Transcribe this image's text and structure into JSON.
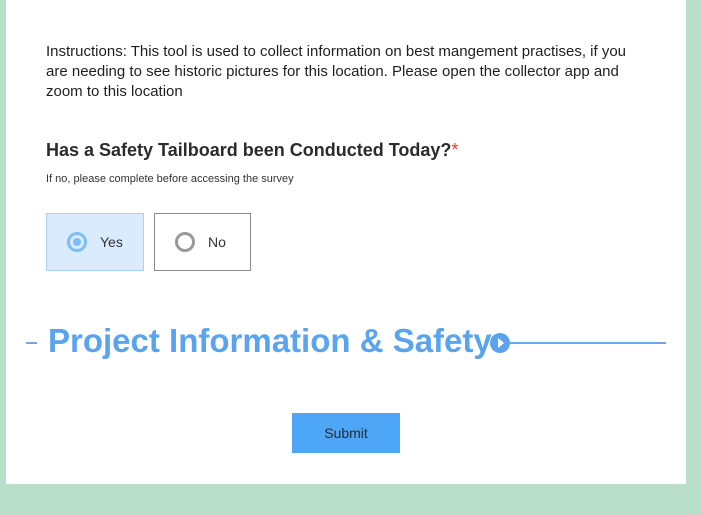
{
  "instructions": "Instructions: This tool is used to collect information on best mangement practises, if you are needing to see historic pictures for this location. Please open the collector app and zoom to this location",
  "question": {
    "label": "Has a Safety Tailboard been Conducted Today?",
    "required_mark": "*",
    "hint": "If no, please complete before accessing the survey",
    "options": [
      {
        "label": "Yes",
        "selected": true
      },
      {
        "label": "No",
        "selected": false
      }
    ]
  },
  "section": {
    "title": "Project Information & Safety",
    "toggle_icon": "play-circle-icon"
  },
  "submit_label": "Submit",
  "colors": {
    "background": "#b9dfca",
    "accent": "#5aa4ef",
    "selected_bg": "#d9ebfd",
    "required": "#d9442c",
    "button": "#4ea6f6"
  }
}
